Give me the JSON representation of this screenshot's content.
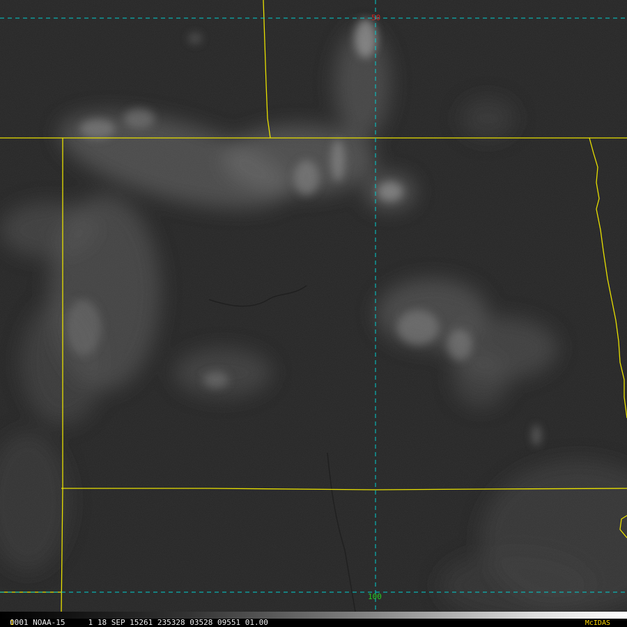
{
  "image": {
    "grid_color": "#00d0d0",
    "border_color": "#e8e000",
    "lat_label_top": {
      "text": "50",
      "color": "#cc2222"
    },
    "lat_label_bottom": {
      "text": "100",
      "color": "#22cc22"
    }
  },
  "status": {
    "frame_number": "1",
    "line": "0001 NOAA-15     1 18 SEP 15261 235328 03528 09551 01.00",
    "brand": "McIDAS",
    "brand_color": "#ffd700"
  }
}
